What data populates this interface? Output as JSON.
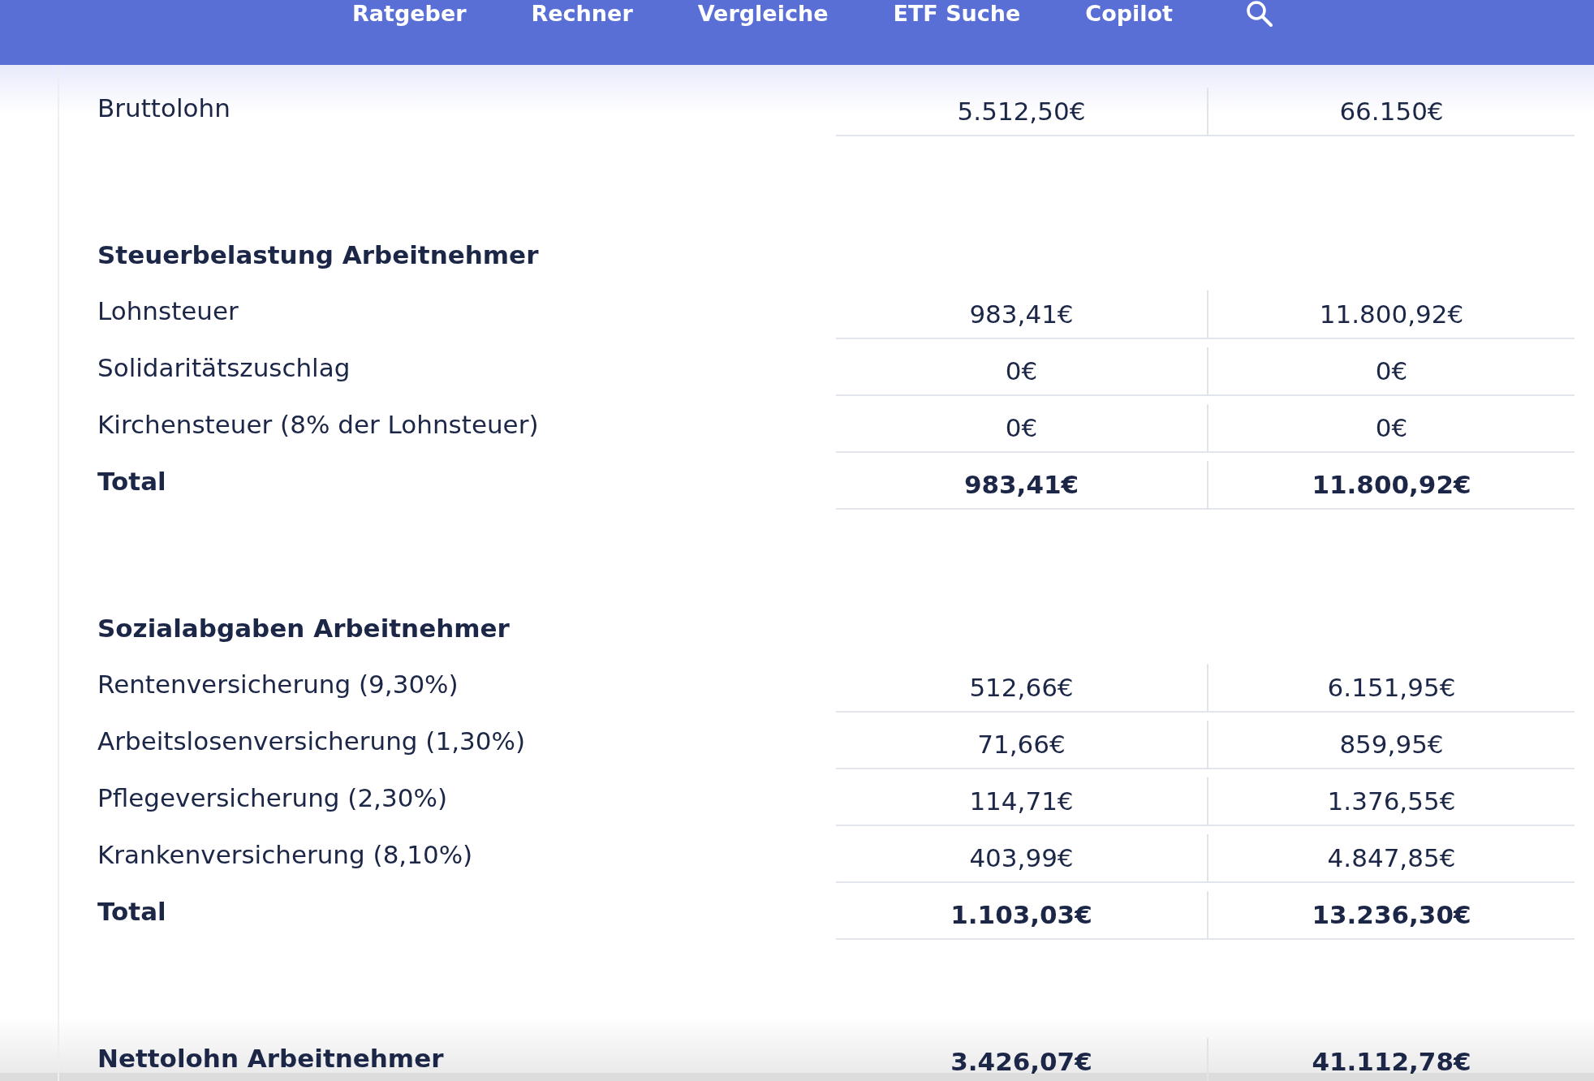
{
  "nav": {
    "items": [
      "Ratgeber",
      "Rechner",
      "Vergleiche",
      "ETF Suche",
      "Copilot"
    ]
  },
  "sections": [
    {
      "rows": [
        {
          "kind": "normal",
          "label": "Bruttolohn",
          "monthly": "5.512,50€",
          "yearly": "66.150€"
        }
      ]
    },
    {
      "heading": "Steuerbelastung Arbeitnehmer",
      "rows": [
        {
          "kind": "normal",
          "label": "Lohnsteuer",
          "monthly": "983,41€",
          "yearly": "11.800,92€"
        },
        {
          "kind": "normal",
          "label": "Solidaritätszuschlag",
          "monthly": "0€",
          "yearly": "0€"
        },
        {
          "kind": "normal",
          "label": "Kirchensteuer (8% der Lohnsteuer)",
          "monthly": "0€",
          "yearly": "0€"
        },
        {
          "kind": "total",
          "label": "Total",
          "monthly": "983,41€",
          "yearly": "11.800,92€"
        }
      ]
    },
    {
      "heading": "Sozialabgaben Arbeitnehmer",
      "rows": [
        {
          "kind": "normal",
          "label": "Rentenversicherung (9,30%)",
          "monthly": "512,66€",
          "yearly": "6.151,95€"
        },
        {
          "kind": "normal",
          "label": "Arbeitslosenversicherung (1,30%)",
          "monthly": "71,66€",
          "yearly": "859,95€"
        },
        {
          "kind": "normal",
          "label": "Pflegeversicherung (2,30%)",
          "monthly": "114,71€",
          "yearly": "1.376,55€"
        },
        {
          "kind": "normal",
          "label": "Krankenversicherung (8,10%)",
          "monthly": "403,99€",
          "yearly": "4.847,85€"
        },
        {
          "kind": "total",
          "label": "Total",
          "monthly": "1.103,03€",
          "yearly": "13.236,30€"
        }
      ]
    },
    {
      "rows": [
        {
          "kind": "total",
          "label": "Nettolohn Arbeitnehmer",
          "monthly": "3.426,07€",
          "yearly": "41.112,78€"
        }
      ]
    }
  ]
}
